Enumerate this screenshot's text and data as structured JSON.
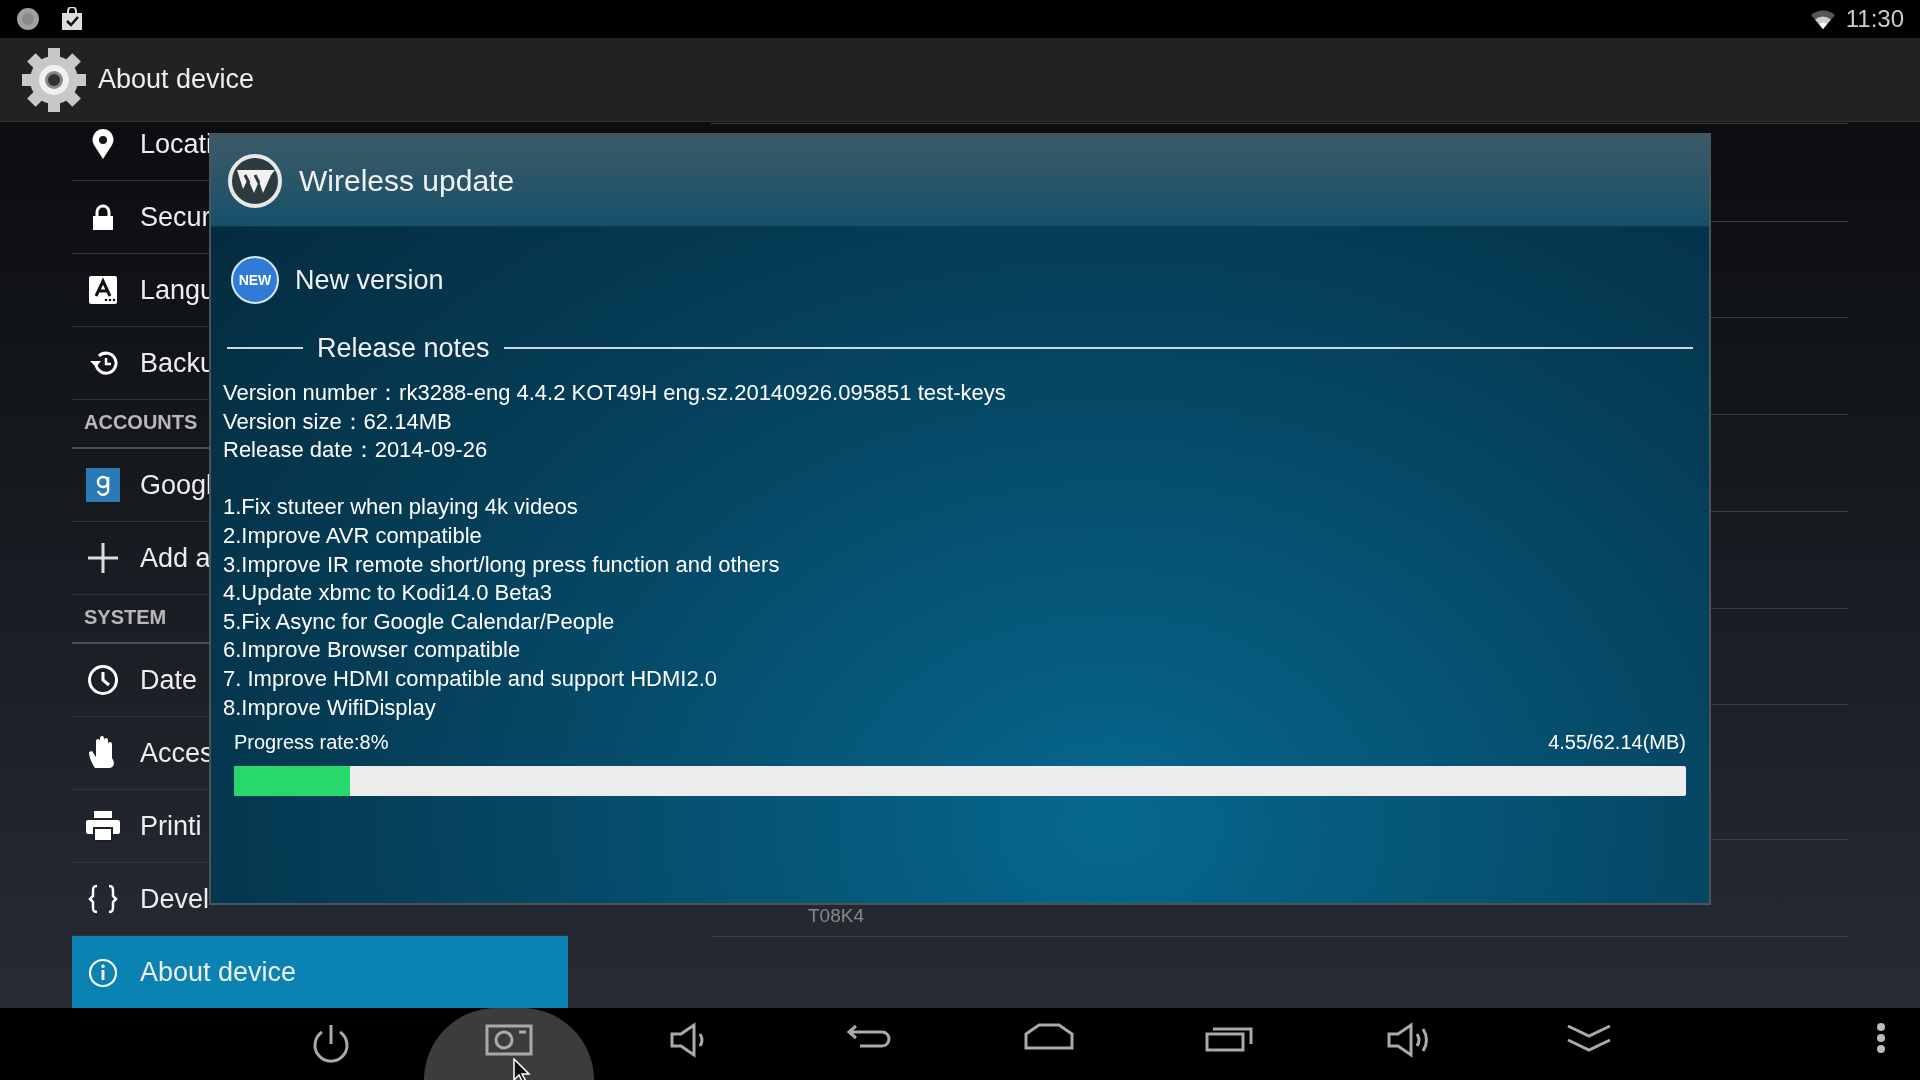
{
  "status_bar": {
    "time": "11:30"
  },
  "action_bar": {
    "title": "About device"
  },
  "sidebar": {
    "items": [
      {
        "kind": "item",
        "label": "Locati",
        "selected": false
      },
      {
        "kind": "item",
        "label": "Secur",
        "selected": false
      },
      {
        "kind": "item",
        "label": "Langu",
        "selected": false
      },
      {
        "kind": "item",
        "label": "Backu",
        "selected": false
      },
      {
        "kind": "header",
        "label": "ACCOUNTS"
      },
      {
        "kind": "item",
        "label": "Googl",
        "selected": false
      },
      {
        "kind": "item",
        "label": "Add a",
        "selected": false
      },
      {
        "kind": "header",
        "label": "SYSTEM"
      },
      {
        "kind": "item",
        "label": "Date",
        "selected": false
      },
      {
        "kind": "item",
        "label": "Acces",
        "selected": false
      },
      {
        "kind": "item",
        "label": "Printi",
        "selected": false
      },
      {
        "kind": "item",
        "label": "Devel",
        "selected": false
      },
      {
        "kind": "item",
        "label": "About device",
        "selected": true
      }
    ]
  },
  "details": {
    "partial_text": "T08K4"
  },
  "dialog": {
    "title": "Wireless update",
    "badge": "NEW",
    "subtitle": "New version",
    "section": "Release notes",
    "info": [
      "Version number：rk3288-eng 4.4.2 KOT49H eng.sz.20140926.095851 test-keys",
      "Version size：62.14MB",
      "Release date：2014-09-26"
    ],
    "changes": [
      "1.Fix stuteer when playing 4k videos",
      "2.Improve AVR compatible",
      "3.Improve IR remote short/long press function and others",
      "4.Update xbmc to Kodi14.0 Beta3",
      "5.Fix Async for Google Calendar/People",
      "6.Improve Browser compatible",
      "7. Improve HDMI compatible and support HDMI2.0",
      "8.Improve WifiDisplay"
    ],
    "progress": {
      "label": "Progress rate:8%",
      "reading": "4.55/62.14(MB)",
      "level": 0.08
    }
  },
  "nav_bar": {
    "buttons": [
      {
        "selected": false
      },
      {
        "selected": true
      },
      {
        "selected": false
      },
      {
        "selected": false
      },
      {
        "selected": false
      },
      {
        "selected": false
      },
      {
        "selected": false
      },
      {
        "selected": false
      },
      {
        "selected": false
      }
    ]
  }
}
